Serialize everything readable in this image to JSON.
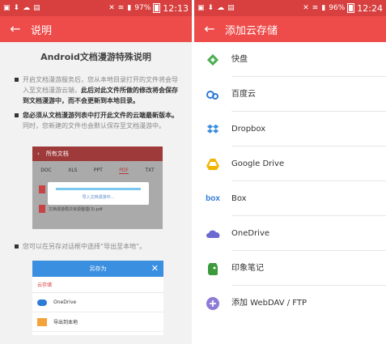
{
  "left": {
    "status": {
      "battery": "97%",
      "time": "12:13"
    },
    "title": "说明",
    "doc_heading": "Android文档漫游特殊说明",
    "para1_a": "开启文档漫游服务后，您从本地目录打开的文件将会导入至文档漫游云端，",
    "para1_b": "此后对此文件所做的修改将会保存到文档漫游中，而不会更新到本地目录。",
    "para2_a": "您必须从文档漫游列表中打开此文件的云端最新版本。",
    "para2_b": "同时，您新建的文件也会默认保存至文档漫游中。",
    "shot1": {
      "header": "所有文档",
      "tabs": [
        "DOC",
        "XLS",
        "PPT",
        "PDF",
        "TXT"
      ],
      "active_tab": "PDF",
      "loading_text": "导入文档漫游中...",
      "file_name": "文档漫游再次资源整理(3).pdf"
    },
    "para3": "您可以在另存对话框中选择“导出至本地”。",
    "shot2": {
      "title": "另存为",
      "crumb": "云存储",
      "items": [
        "OneDrive",
        "导出到本地"
      ]
    }
  },
  "right": {
    "status": {
      "battery": "96%",
      "time": "12:24"
    },
    "title": "添加云存储",
    "services": [
      {
        "label": "快盘",
        "icon": "kuaipan-icon",
        "color": "#4caf50"
      },
      {
        "label": "百度云",
        "icon": "baidu-cloud-icon",
        "color": "#2f7bd8"
      },
      {
        "label": "Dropbox",
        "icon": "dropbox-icon",
        "color": "#3b8fe0"
      },
      {
        "label": "Google Drive",
        "icon": "google-drive-icon",
        "color": "#f2b600"
      },
      {
        "label": "Box",
        "icon": "box-icon",
        "color": "#2f7bd8"
      },
      {
        "label": "OneDrive",
        "icon": "onedrive-icon",
        "color": "#6a6ad0"
      },
      {
        "label": "印象笔记",
        "icon": "evernote-icon",
        "color": "#3b9a3b"
      },
      {
        "label": "添加 WebDAV / FTP",
        "icon": "add-icon",
        "color": "#8e7bd6"
      }
    ]
  },
  "colors": {
    "statusbar": "#d84040",
    "appbar": "#ee4c4a"
  }
}
